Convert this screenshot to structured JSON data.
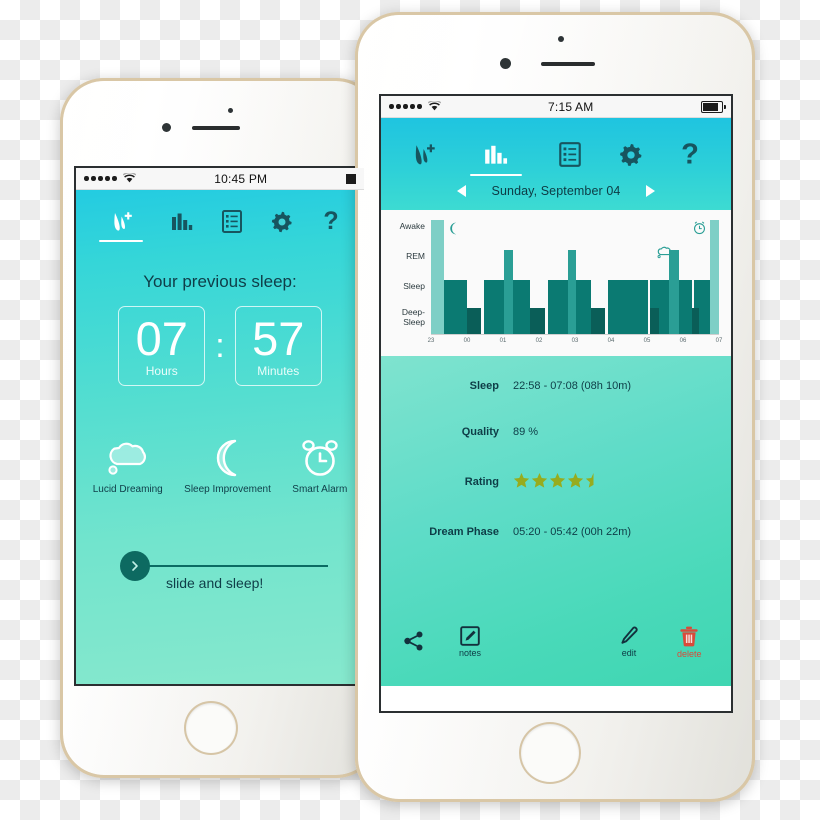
{
  "left_phone": {
    "status_bar": {
      "time": "10:45 PM",
      "signal_dots": 5,
      "wifi_icon": "wifi-icon",
      "battery_icon": "battery-icon"
    },
    "tabs": [
      {
        "id": "home",
        "icon": "leaf-plus-icon",
        "active": true
      },
      {
        "id": "stats",
        "icon": "bar-chart-icon",
        "active": false
      },
      {
        "id": "list",
        "icon": "list-document-icon",
        "active": false
      },
      {
        "id": "settings",
        "icon": "gear-icon",
        "active": false
      },
      {
        "id": "help",
        "icon": "question-mark-icon",
        "active": false
      }
    ],
    "title": "Your previous sleep:",
    "hours": {
      "value": "07",
      "unit": "Hours"
    },
    "separator": ":",
    "minutes": {
      "value": "57",
      "unit": "Minutes"
    },
    "features": [
      {
        "icon": "thought-cloud-icon",
        "label": "Lucid Dreaming"
      },
      {
        "icon": "crescent-moon-icon",
        "label": "Sleep Improvement"
      },
      {
        "icon": "alarm-clock-icon",
        "label": "Smart Alarm"
      }
    ],
    "slider": {
      "label": "slide and sleep!",
      "knob_icon": "chevron-right-icon"
    }
  },
  "right_phone": {
    "status_bar": {
      "time": "7:15 AM",
      "signal_dots": 5,
      "wifi_icon": "wifi-icon",
      "battery_icon": "battery-icon"
    },
    "tabs": [
      {
        "id": "home",
        "icon": "leaf-plus-icon",
        "active": false
      },
      {
        "id": "stats",
        "icon": "bar-chart-icon",
        "active": true
      },
      {
        "id": "list",
        "icon": "list-document-icon",
        "active": false
      },
      {
        "id": "settings",
        "icon": "gear-icon",
        "active": false
      },
      {
        "id": "help",
        "icon": "question-mark-icon",
        "active": false
      }
    ],
    "date_nav": {
      "prev_icon": "arrow-left-icon",
      "date": "Sunday, September 04",
      "next_icon": "arrow-right-icon"
    },
    "stats": [
      {
        "label": "Sleep",
        "value": "22:58 - 07:08  (08h 10m)"
      },
      {
        "label": "Quality",
        "value": "89 %"
      },
      {
        "label": "Rating",
        "value": "",
        "rating": 4.5,
        "max_rating": 5
      },
      {
        "label": "Dream Phase",
        "value": "05:20 - 05:42  (00h 22m)"
      }
    ],
    "toolbar": [
      {
        "id": "share",
        "icon": "share-icon",
        "label": ""
      },
      {
        "id": "notes",
        "icon": "notes-pencil-icon",
        "label": "notes"
      },
      {
        "id": "edit",
        "icon": "pencil-icon",
        "label": "edit"
      },
      {
        "id": "delete",
        "icon": "trash-icon",
        "label": "delete"
      }
    ]
  },
  "colors": {
    "header_cyan": "#1fc4e0",
    "header_teal": "#3ddbd2",
    "panel_mint": "#5fdcc8",
    "bar_light": "#7ecfc6",
    "bar_mid": "#2a9e95",
    "bar_sleep": "#0b7a72",
    "bar_deep": "#0a5e58",
    "text_dark": "#0e3d47",
    "star_olive": "#97ac1e",
    "delete_red": "#d94a3a"
  },
  "chart_data": {
    "type": "bar",
    "title": "",
    "xlabel": "",
    "ylabel": "",
    "y_categories": [
      "Awake",
      "REM",
      "Sleep",
      "Deep-Sleep"
    ],
    "x_tick_labels": [
      "23",
      "00",
      "01",
      "02",
      "03",
      "04",
      "05",
      "06",
      "07"
    ],
    "grid": false,
    "legend": false,
    "annotations": [
      {
        "icon": "crescent-moon-icon",
        "x": "23",
        "level": "Awake",
        "meaning": "sleep-start"
      },
      {
        "icon": "thought-cloud-icon",
        "x": "05",
        "level": "REM",
        "meaning": "dream-phase"
      },
      {
        "icon": "alarm-clock-icon",
        "x": "07",
        "level": "Awake",
        "meaning": "alarm"
      }
    ],
    "segments": [
      {
        "start": 0.0,
        "end": 0.045,
        "level": "Awake",
        "tone": "light"
      },
      {
        "start": 0.045,
        "end": 0.125,
        "level": "Sleep",
        "tone": "sleep"
      },
      {
        "start": 0.125,
        "end": 0.175,
        "level": "Deep-Sleep",
        "tone": "deep"
      },
      {
        "start": 0.185,
        "end": 0.255,
        "level": "Sleep",
        "tone": "sleep"
      },
      {
        "start": 0.255,
        "end": 0.285,
        "level": "REM",
        "tone": "mid"
      },
      {
        "start": 0.285,
        "end": 0.345,
        "level": "Sleep",
        "tone": "sleep"
      },
      {
        "start": 0.345,
        "end": 0.395,
        "level": "Deep-Sleep",
        "tone": "deep"
      },
      {
        "start": 0.405,
        "end": 0.475,
        "level": "Sleep",
        "tone": "sleep"
      },
      {
        "start": 0.475,
        "end": 0.505,
        "level": "REM",
        "tone": "mid"
      },
      {
        "start": 0.505,
        "end": 0.555,
        "level": "Sleep",
        "tone": "sleep"
      },
      {
        "start": 0.555,
        "end": 0.605,
        "level": "Deep-Sleep",
        "tone": "deep"
      },
      {
        "start": 0.615,
        "end": 0.755,
        "level": "Sleep",
        "tone": "sleep"
      },
      {
        "start": 0.762,
        "end": 0.825,
        "level": "Sleep",
        "tone": "sleep"
      },
      {
        "start": 0.825,
        "end": 0.862,
        "level": "REM",
        "tone": "mid"
      },
      {
        "start": 0.862,
        "end": 0.905,
        "level": "Sleep",
        "tone": "sleep"
      },
      {
        "start": 0.912,
        "end": 0.968,
        "level": "Sleep",
        "tone": "sleep"
      },
      {
        "start": 0.968,
        "end": 1.0,
        "level": "Awake",
        "tone": "light"
      }
    ],
    "deep_overlays": [
      {
        "start": 0.125,
        "end": 0.175
      },
      {
        "start": 0.345,
        "end": 0.395
      },
      {
        "start": 0.555,
        "end": 0.605
      },
      {
        "start": 0.762,
        "end": 0.79
      },
      {
        "start": 0.905,
        "end": 0.93
      }
    ],
    "summary": {
      "sleep_window": "22:58 - 07:08",
      "total_duration": "08h 10m",
      "quality_percent": 89,
      "rating": 4.5,
      "dream_phase_window": "05:20 - 05:42",
      "dream_phase_duration": "00h 22m"
    }
  }
}
